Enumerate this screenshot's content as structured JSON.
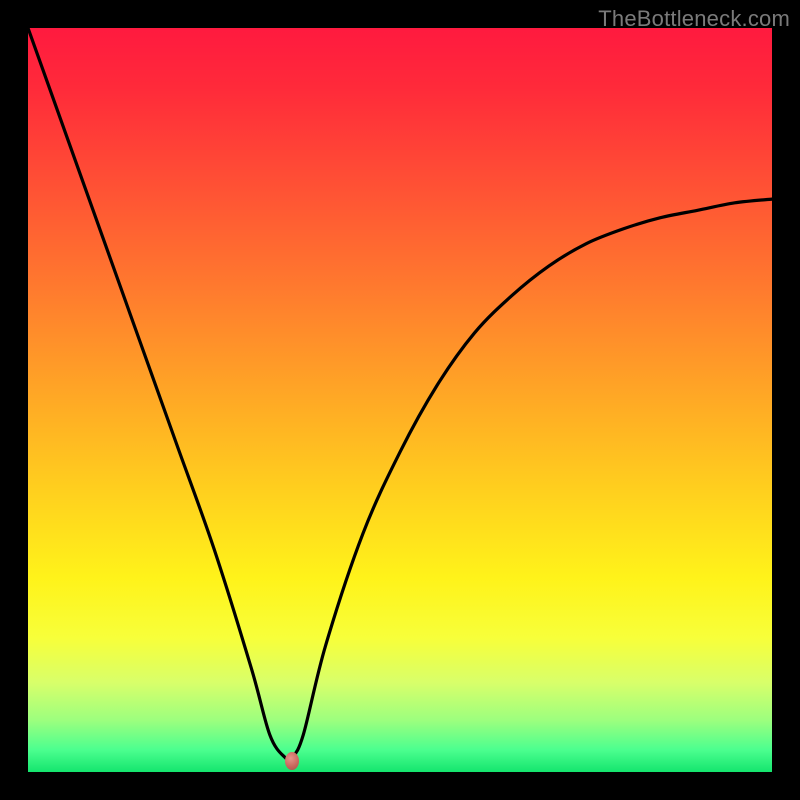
{
  "watermark": "TheBottleneck.com",
  "colors": {
    "frame": "#000000",
    "gradient_top": "#ff1a3f",
    "gradient_bottom": "#14e56e",
    "curve": "#000000",
    "marker": "#c8695e"
  },
  "chart_data": {
    "type": "line",
    "title": "",
    "xlabel": "",
    "ylabel": "",
    "xlim": [
      0,
      1
    ],
    "ylim": [
      0,
      1
    ],
    "series": [
      {
        "name": "curve",
        "x": [
          0.0,
          0.05,
          0.1,
          0.15,
          0.2,
          0.25,
          0.3,
          0.325,
          0.345,
          0.355,
          0.37,
          0.4,
          0.45,
          0.5,
          0.55,
          0.6,
          0.65,
          0.7,
          0.75,
          0.8,
          0.85,
          0.9,
          0.95,
          1.0
        ],
        "y": [
          1.0,
          0.86,
          0.72,
          0.58,
          0.44,
          0.3,
          0.14,
          0.05,
          0.02,
          0.02,
          0.05,
          0.17,
          0.32,
          0.43,
          0.52,
          0.59,
          0.64,
          0.68,
          0.71,
          0.73,
          0.745,
          0.755,
          0.765,
          0.77
        ]
      }
    ],
    "marker": {
      "x": 0.355,
      "y": 0.015
    },
    "note": "Axes have no visible tick labels; x and y are normalized 0–1 across the gradient plot area. Values are read off the curve geometry."
  }
}
